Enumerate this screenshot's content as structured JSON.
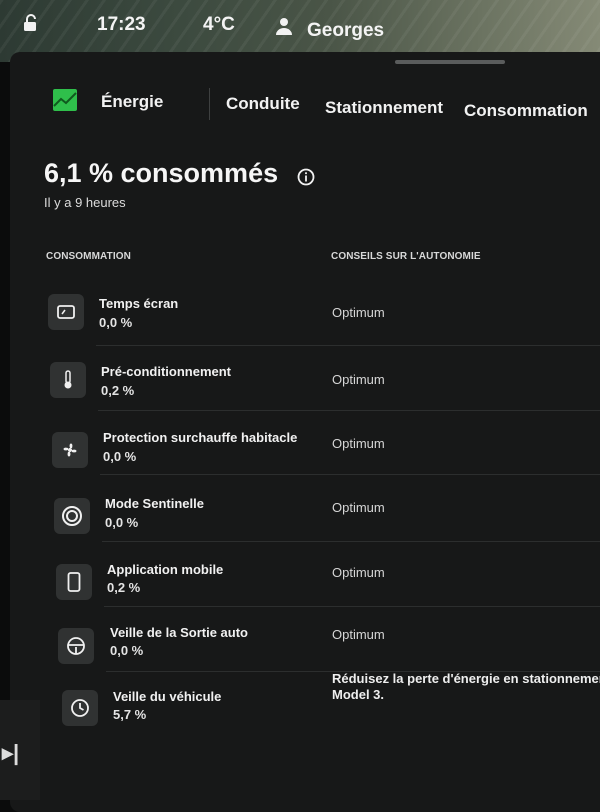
{
  "status": {
    "time": "17:23",
    "temperature": "4°C",
    "user": "Georges"
  },
  "tabs": [
    {
      "label": "Énergie"
    },
    {
      "label": "Conduite"
    },
    {
      "label": "Stationnement"
    },
    {
      "label": "Consommation"
    }
  ],
  "summary": {
    "title": "6,1 % consommés",
    "subtitle": "Il y a 9 heures"
  },
  "columns": {
    "consumption": "CONSOMMATION",
    "tips": "CONSEILS SUR L'AUTONOMIE"
  },
  "rows": [
    {
      "name": "Temps écran",
      "value": "0,0 %",
      "tip": "Optimum",
      "icon": "screen-icon"
    },
    {
      "name": "Pré-conditionnement",
      "value": "0,2 %",
      "tip": "Optimum",
      "icon": "thermometer-icon"
    },
    {
      "name": "Protection surchauffe habitacle",
      "value": "0,0 %",
      "tip": "Optimum",
      "icon": "fan-icon"
    },
    {
      "name": "Mode Sentinelle",
      "value": "0,0 %",
      "tip": "Optimum",
      "icon": "sentry-icon"
    },
    {
      "name": "Application mobile",
      "value": "0,2 %",
      "tip": "Optimum",
      "icon": "phone-icon"
    },
    {
      "name": "Veille de la Sortie auto",
      "value": "0,0 %",
      "tip": "Optimum",
      "icon": "steering-wheel-icon"
    },
    {
      "name": "Veille du véhicule",
      "value": "5,7 %",
      "tip_line1": "Réduisez la perte d'énergie en stationnement e",
      "tip_line2": "Model 3.",
      "icon": "clock-icon"
    }
  ],
  "colors": {
    "energy_icon": "#2fbf4b",
    "panel": "#171818",
    "background": "#0b0c0c"
  }
}
